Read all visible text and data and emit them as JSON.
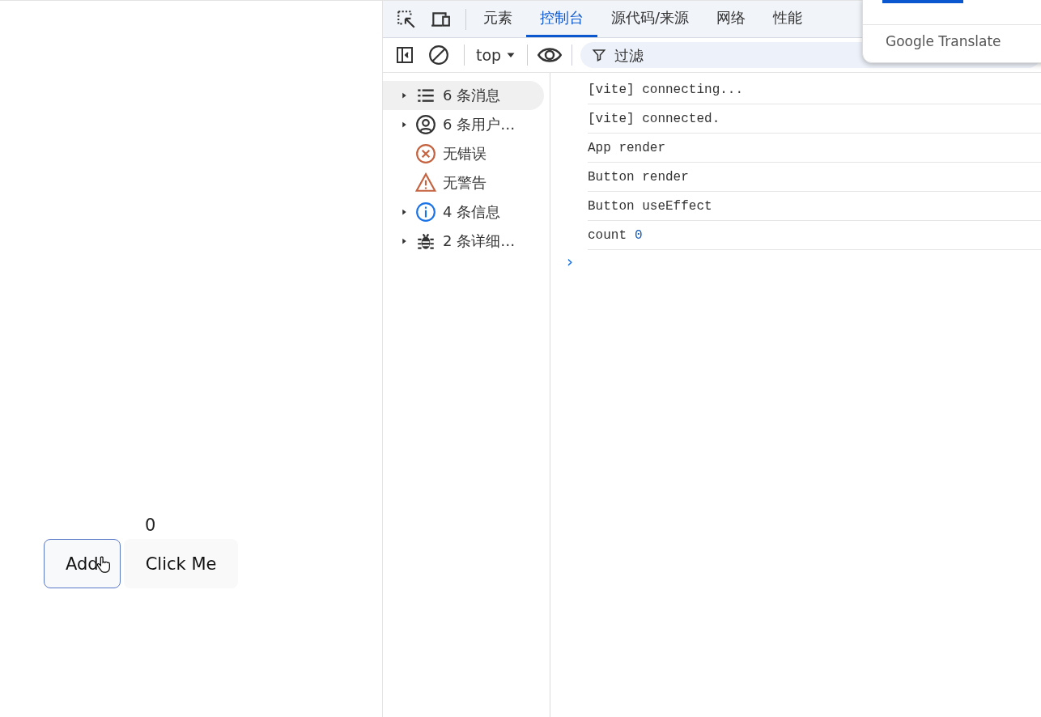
{
  "app": {
    "counter": "0",
    "buttons": [
      {
        "label": "Add",
        "focused": true,
        "hovered": true
      },
      {
        "label": "Click Me",
        "focused": false,
        "hovered": false
      }
    ]
  },
  "devtools": {
    "tabs": [
      {
        "label": "元素",
        "selected": false
      },
      {
        "label": "控制台",
        "selected": true
      },
      {
        "label": "源代码/来源",
        "selected": false
      },
      {
        "label": "网络",
        "selected": false
      },
      {
        "label": "性能",
        "selected": false
      }
    ],
    "context": "top",
    "filter": {
      "placeholder": "过滤"
    },
    "sidebar": [
      {
        "kind": "list",
        "label": "6 条消息",
        "expandable": true,
        "selected": true
      },
      {
        "kind": "user",
        "label": "6 条用户…",
        "expandable": true,
        "selected": false
      },
      {
        "kind": "error",
        "label": "无错误",
        "expandable": false,
        "selected": false
      },
      {
        "kind": "warning",
        "label": "无警告",
        "expandable": false,
        "selected": false
      },
      {
        "kind": "info",
        "label": "4 条信息",
        "expandable": true,
        "selected": false
      },
      {
        "kind": "bug",
        "label": "2 条详细…",
        "expandable": true,
        "selected": false
      }
    ],
    "messages": [
      {
        "text": "[vite] connecting..."
      },
      {
        "text": "[vite] connected."
      },
      {
        "text": "App render"
      },
      {
        "text": "Button render"
      },
      {
        "text": "Button useEffect"
      },
      {
        "text": "count",
        "value": "0"
      }
    ],
    "prompt": "›"
  },
  "translate_popup": {
    "title": "Google Translate"
  }
}
